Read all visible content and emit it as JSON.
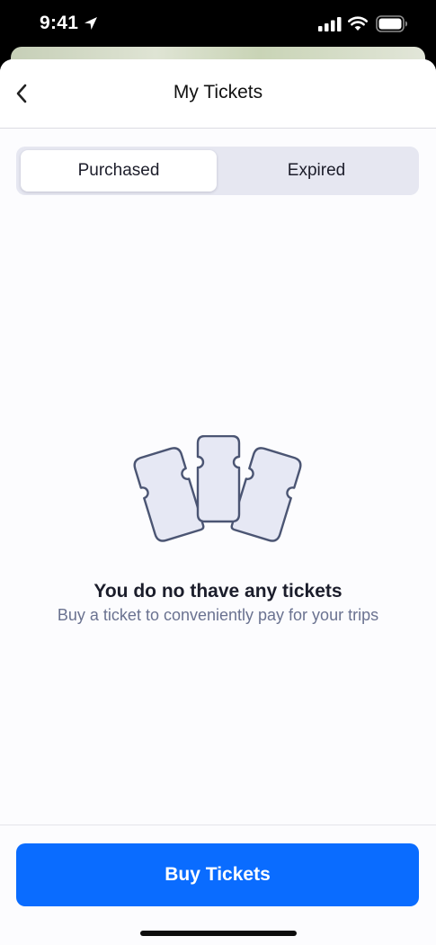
{
  "status_bar": {
    "time": "9:41",
    "icons": [
      "location-arrow-icon",
      "cellular-signal-icon",
      "wifi-icon",
      "battery-icon"
    ]
  },
  "nav": {
    "title": "My Tickets",
    "back_icon": "chevron-left-icon"
  },
  "tabs": [
    {
      "label": "Purchased",
      "selected": true
    },
    {
      "label": "Expired",
      "selected": false
    }
  ],
  "empty_state": {
    "illustration": "tickets-icon",
    "title": "You do no thave any tickets",
    "subtitle": "Buy a ticket to conveniently pay for your trips"
  },
  "actions": {
    "buy_label": "Buy Tickets"
  },
  "colors": {
    "accent": "#0a6cff",
    "segment_bg": "#e6e7f1",
    "ticket_fill": "#e6e8f4",
    "ticket_stroke": "#4b5573",
    "subtitle_text": "#6a7290"
  }
}
